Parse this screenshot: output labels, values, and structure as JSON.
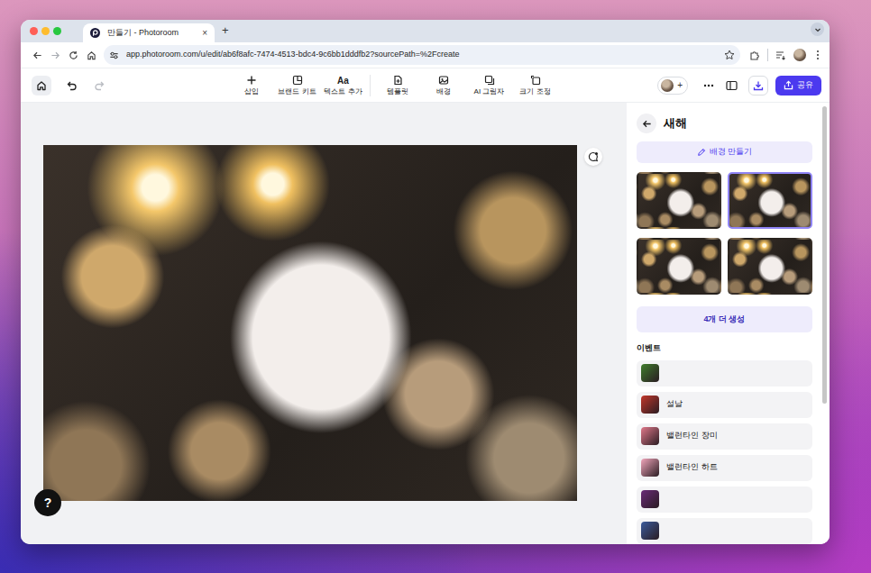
{
  "browser": {
    "tabs": [
      {
        "title": "만들기 - Photoroom",
        "close": "×",
        "selected": true
      }
    ],
    "new_tab": "+",
    "address": "app.photoroom.com/u/edit/ab6f8afc-7474-4513-bdc4-9c6bb1dddfb2?sourcePath=%2Fcreate",
    "bookmarked": false
  },
  "editor": {
    "undo": {
      "disabled": false
    },
    "redo": {
      "disabled": true
    },
    "tool_groups": [
      {
        "tools": [
          {
            "label": "삽입"
          },
          {
            "label": "브랜드 키트"
          },
          {
            "label": "텍스트 추가",
            "glyph": "Aa"
          }
        ]
      },
      {
        "tools": [
          {
            "label": "템플릿"
          },
          {
            "label": "배경"
          },
          {
            "label": "AI 그림자"
          },
          {
            "label": "크기 조정"
          }
        ]
      }
    ],
    "invite": "+",
    "share": "공유",
    "help": "?"
  },
  "panel": {
    "title": "새해",
    "generate_button": "배경 만들기",
    "thumbnails": [
      {
        "selected": false
      },
      {
        "selected": true
      },
      {
        "selected": false
      },
      {
        "selected": false
      }
    ],
    "more_button": "4개 더 생성",
    "section": "이벤트",
    "events": [
      {
        "color": "#3f7d2c"
      },
      {
        "label": "설날",
        "color": "#c2372b"
      },
      {
        "label": "밸런타인 장미",
        "color": "#e0788a"
      },
      {
        "label": "밸런타인 하트",
        "color": "#f1a6bb"
      },
      {
        "color": "#6a2b78"
      },
      {
        "color": "#3b5b9c"
      }
    ]
  }
}
